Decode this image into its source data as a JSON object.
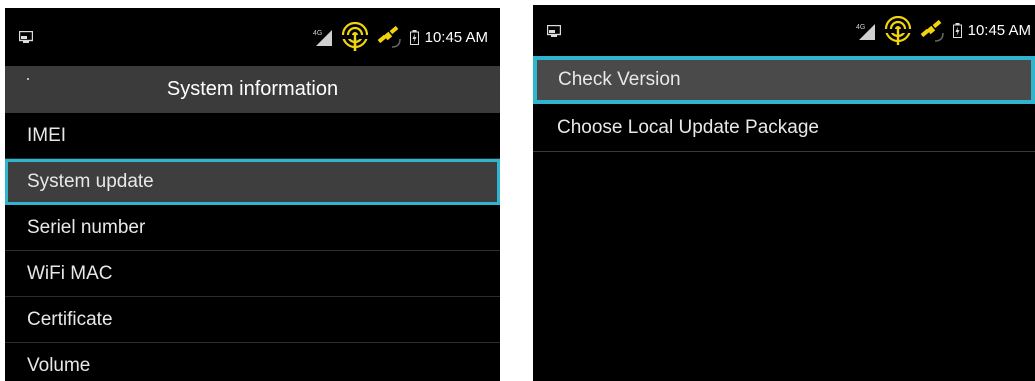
{
  "left": {
    "status": {
      "time": "10:45 AM",
      "network_badge": "4G"
    },
    "title": "System information",
    "items": [
      {
        "label": "IMEI"
      },
      {
        "label": "System update"
      },
      {
        "label": "Seriel number"
      },
      {
        "label": "WiFi MAC"
      },
      {
        "label": "Certificate"
      },
      {
        "label": "Volume"
      }
    ],
    "selected_index": 1
  },
  "right": {
    "status": {
      "time": "10:45 AM",
      "network_badge": "4G"
    },
    "items": [
      {
        "label": "Check Version"
      },
      {
        "label": "Choose Local Update Package"
      }
    ],
    "selected_index": 0
  },
  "colors": {
    "accent": "#2fb5cf",
    "status_icon_yellow": "#f2d40a"
  },
  "icons": [
    "screenshot-icon",
    "signal-icon",
    "hotspot-icon",
    "gps-icon",
    "battery-icon"
  ]
}
